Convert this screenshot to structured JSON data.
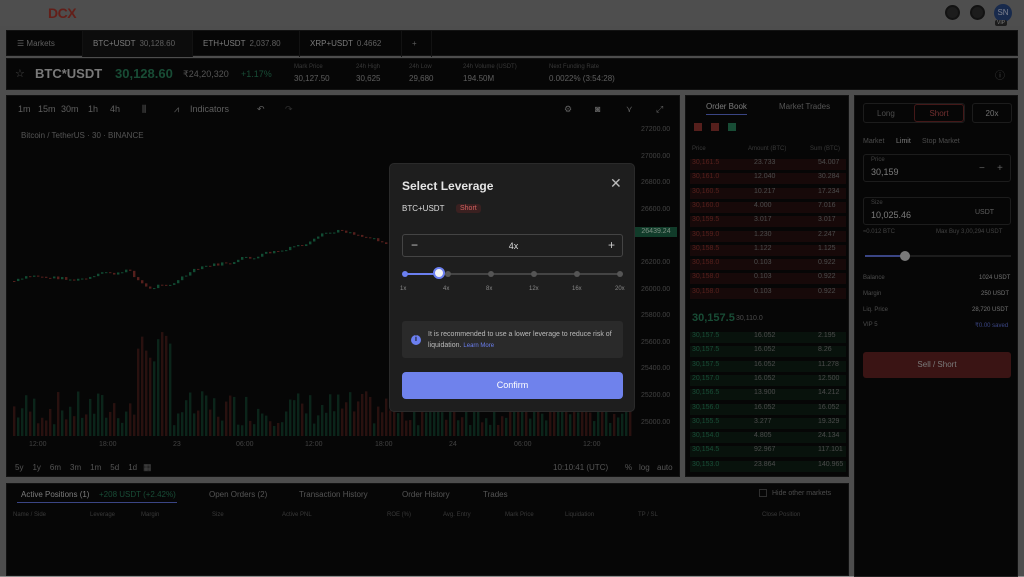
{
  "app": {
    "logo": "DCX",
    "avatar_initials": "SN",
    "vip": "VIP"
  },
  "tabs": {
    "markets": "Markets",
    "items": [
      {
        "pair": "BTC+USDT",
        "price": "30,128.60"
      },
      {
        "pair": "ETH+USDT",
        "price": "2,037.80"
      },
      {
        "pair": "XRP+USDT",
        "price": "0.4662"
      }
    ],
    "add": "+"
  },
  "ticker": {
    "pair": "BTC*USDT",
    "price": "30,128.60",
    "inr": "₹24,20,320",
    "change": "+1.17%",
    "stats": [
      {
        "label": "Mark Price",
        "value": "30,127.50"
      },
      {
        "label": "24h High",
        "value": "30,625"
      },
      {
        "label": "24h Low",
        "value": "29,680"
      },
      {
        "label": "24h Volume (USDT)",
        "value": "194.50M"
      },
      {
        "label": "Next Funding Rate",
        "value": "0.0022% (3:54:28)"
      }
    ]
  },
  "chart": {
    "intervals": [
      "1m",
      "15m",
      "30m",
      "1h",
      "4h"
    ],
    "indicators": "Indicators",
    "symbol": "Bitcoin / TetherUS · 30 · BINANCE",
    "prices": [
      "27200.00",
      "27000.00",
      "26800.00",
      "26600.00",
      "26400.00",
      "26200.00",
      "26000.00",
      "25800.00",
      "25600.00",
      "25400.00",
      "25200.00",
      "25000.00"
    ],
    "last_price": "26439.24",
    "times": [
      "12:00",
      "18:00",
      "23",
      "06:00",
      "12:00",
      "18:00",
      "24",
      "06:00",
      "12:00"
    ],
    "ranges": [
      "5y",
      "1y",
      "6m",
      "3m",
      "1m",
      "5d",
      "1d"
    ],
    "clock": "10:10:41 (UTC)",
    "opts": [
      "%",
      "log",
      "auto"
    ]
  },
  "orderbook": {
    "tabs": [
      "Order Book",
      "Market Trades"
    ],
    "headers": [
      "Price",
      "Amount (BTC)",
      "Sum (BTC)"
    ],
    "asks": [
      [
        "30,161.5",
        "23.733",
        "54.007"
      ],
      [
        "30,161.0",
        "12.040",
        "30.284"
      ],
      [
        "30,160.5",
        "10.217",
        "17.234"
      ],
      [
        "30,160.0",
        "4.000",
        "7.016"
      ],
      [
        "30,159.5",
        "3.017",
        "3.017"
      ],
      [
        "30,159.0",
        "1.230",
        "2.247"
      ],
      [
        "30,158.5",
        "1.122",
        "1.125"
      ],
      [
        "30,158.0",
        "0.103",
        "0.922"
      ],
      [
        "30,158.0",
        "0.103",
        "0.922"
      ],
      [
        "30,158.0",
        "0.103",
        "0.922"
      ]
    ],
    "mid": "30,157.5",
    "mid_sub": "30,110.0",
    "bids": [
      [
        "30,157.5",
        "16.052",
        "2.195"
      ],
      [
        "30,157.5",
        "16.052",
        "8.26"
      ],
      [
        "30,157.5",
        "16.052",
        "11.278"
      ],
      [
        "20,157.0",
        "16.052",
        "12.500"
      ],
      [
        "30,156.5",
        "13.900",
        "14.212"
      ],
      [
        "30,156.0",
        "16.052",
        "16.052"
      ],
      [
        "30,155.5",
        "3.277",
        "19.329"
      ],
      [
        "30,154.0",
        "4.805",
        "24.134"
      ],
      [
        "30,154.5",
        "92.967",
        "117.101"
      ],
      [
        "30,153.0",
        "23.864",
        "140.965"
      ]
    ]
  },
  "trade": {
    "long": "Long",
    "short": "Short",
    "lev": "20x",
    "types": [
      "Market",
      "Limit",
      "Stop Market"
    ],
    "price_label": "Price",
    "price": "30,159",
    "size_label": "Size",
    "size": "10,025.46",
    "unit": "USDT",
    "btc": "≈0.012 BTC",
    "max": "Max Buy 3,00,294 USDT",
    "rows": [
      [
        "Balance",
        "1024 USDT"
      ],
      [
        "Margin",
        "250 USDT"
      ],
      [
        "Liq. Price",
        "28,720 USDT"
      ]
    ],
    "vip": "VIP 5",
    "saved": "₹0.00 saved",
    "submit": "Sell / Short"
  },
  "bottom": {
    "tabs": [
      "Active Positions (1)",
      "+208 USDT (+2.42%)",
      "Open Orders (2)",
      "Transaction History",
      "Order History",
      "Trades"
    ],
    "hide": "Hide other markets",
    "cols": [
      "Name / Side",
      "Leverage",
      "Margin",
      "Size",
      "Active PNL",
      "ROE (%)",
      "Avg. Entry",
      "Mark Price",
      "Liquidation",
      "TP / SL",
      "Close Position"
    ]
  },
  "modal": {
    "title": "Select Leverage",
    "pair": "BTC+USDT",
    "side": "Short",
    "value": "4x",
    "marks": [
      "1x",
      "4x",
      "8x",
      "12x",
      "16x",
      "20x"
    ],
    "selected_fraction": 0.158,
    "notice": "It is recommended to use a lower leverage to reduce risk of liquidation.",
    "learn": "Learn More",
    "confirm": "Confirm",
    "close": "✕"
  }
}
